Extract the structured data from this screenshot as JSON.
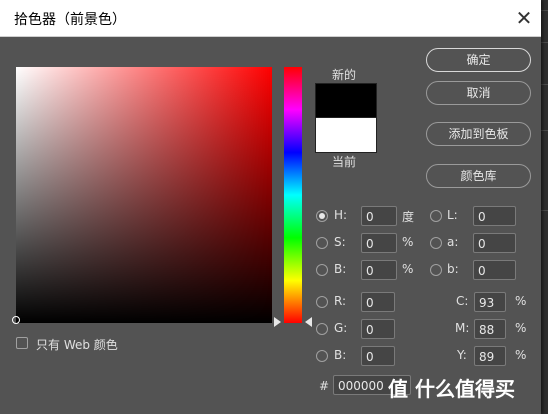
{
  "dialog": {
    "title": "拾色器（前景色）",
    "close_glyph": "✕"
  },
  "preview": {
    "new_label": "新的",
    "current_label": "当前",
    "new_color": "#000000",
    "current_color": "#ffffff"
  },
  "buttons": {
    "ok": "确定",
    "cancel": "取消",
    "add_to_swatches": "添加到色板",
    "color_libraries": "颜色库"
  },
  "fields": {
    "H": {
      "label": "H:",
      "value": "0",
      "unit": "度",
      "selected": true
    },
    "S": {
      "label": "S:",
      "value": "0",
      "unit": "%"
    },
    "Bri": {
      "label": "B:",
      "value": "0",
      "unit": "%"
    },
    "R": {
      "label": "R:",
      "value": "0"
    },
    "G": {
      "label": "G:",
      "value": "0"
    },
    "Blue": {
      "label": "B:",
      "value": "0"
    },
    "L": {
      "label": "L:",
      "value": "0"
    },
    "a": {
      "label": "a:",
      "value": "0"
    },
    "b": {
      "label": "b:",
      "value": "0"
    },
    "C": {
      "label": "C:",
      "value": "93",
      "unit": "%"
    },
    "M": {
      "label": "M:",
      "value": "88",
      "unit": "%"
    },
    "Y": {
      "label": "Y:",
      "value": "89",
      "unit": "%"
    }
  },
  "hex": {
    "label": "#",
    "value": "000000"
  },
  "web_colors_only": {
    "label": "只有 Web 颜色",
    "checked": false
  },
  "watermark": "值 什么值得买",
  "colors": {
    "dialog_bg": "#535353",
    "hue": "#ff0000"
  }
}
